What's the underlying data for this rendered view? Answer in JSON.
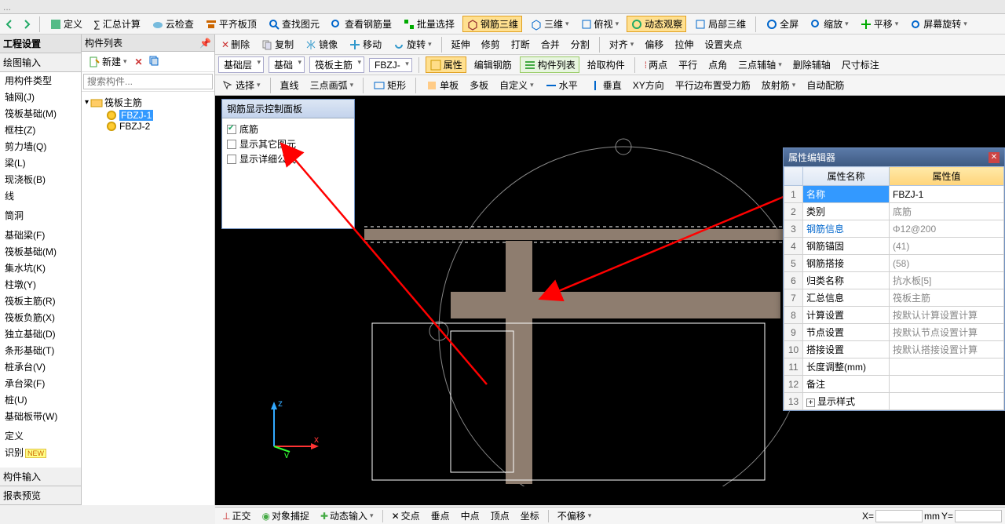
{
  "top_menu_tail": "...",
  "toolbar1": {
    "ding": "定义",
    "summary": "∑ 汇总计算",
    "cloud": "云检查",
    "align_top": "平齐板顶",
    "find_el": "查找图元",
    "find_rebar": "查看钢筋量",
    "batch_sel": "批量选择",
    "rebar_3d": "钢筋三维",
    "sanwei": "三维",
    "fushi": "俯视",
    "dyn_obs": "动态观察",
    "local_3d": "局部三维",
    "full": "全屏",
    "zoom": "缩放",
    "pan": "平移",
    "rot_scr": "屏幕旋转"
  },
  "toolbar2": {
    "del": "删除",
    "copy": "复制",
    "mirror": "镜像",
    "move": "移动",
    "rotate": "旋转",
    "ext": "延伸",
    "trim": "修剪",
    "break": "打断",
    "merge": "合并",
    "split": "分割",
    "align": "对齐",
    "offset": "偏移",
    "stretch": "拉伸",
    "set_pt": "设置夹点"
  },
  "toolbar3": {
    "layer": "基础层",
    "group": "基础",
    "sub": "筏板主筋",
    "code": "FBZJ-",
    "attr": "属性",
    "edit_rb": "编辑钢筋",
    "comp_list": "构件列表",
    "pick": "拾取构件",
    "two_pt": "两点",
    "parallel": "平行",
    "pt_ang": "点角",
    "tri_aux": "三点辅轴",
    "del_aux": "删除辅轴",
    "dim": "尺寸标注"
  },
  "toolbar4": {
    "select": "选择",
    "line": "直线",
    "arc3": "三点画弧",
    "rect": "矩形",
    "single": "单板",
    "multi": "多板",
    "custom": "自定义",
    "horiz": "水平",
    "vert": "垂直",
    "xy": "XY方向",
    "par_side": "平行边布置受力筋",
    "rad": "放射筋",
    "auto": "自动配筋"
  },
  "eng": {
    "title": "工程设置",
    "draw_in": "绘图输入"
  },
  "left_items": [
    "用构件类型",
    "轴网(J)",
    "筏板基础(M)",
    "框柱(Z)",
    "剪力墙(Q)",
    "梁(L)",
    "现浇板(B)",
    "线",
    "",
    "筒洞",
    "",
    "基础梁(F)",
    "筏板基础(M)",
    "集水坑(K)",
    "柱墩(Y)",
    "筏板主筋(R)",
    "筏板负筋(X)",
    "独立基础(D)",
    "条形基础(T)",
    "桩承台(V)",
    "承台梁(F)",
    "桩(U)",
    "基础板带(W)",
    "",
    "定义",
    "识别"
  ],
  "left_new_badge": "NEW",
  "left_footer": [
    "构件输入",
    "报表预览"
  ],
  "tree": {
    "title": "构件列表",
    "new_btn": "新建",
    "search_ph": "搜索构件...",
    "root": "筏板主筋",
    "c1": "FBZJ-1",
    "c2": "FBZJ-2"
  },
  "rebar_panel": {
    "title": "钢筋显示控制面板",
    "opt1": "底筋",
    "opt2": "显示其它图元",
    "opt3": "显示详细公式"
  },
  "status": {
    "ortho": "正交",
    "snap": "对象捕捉",
    "dyn_in": "动态输入",
    "cross": "交点",
    "vert": "垂点",
    "mid": "中点",
    "vertex": "顶点",
    "sit": "坐标",
    "no_off": "不偏移",
    "xl": "X=",
    "mm": "mm",
    "yl": "Y="
  },
  "prop": {
    "title": "属性编辑器",
    "h_name": "属性名称",
    "h_val": "属性值",
    "rows": [
      {
        "n": "1",
        "k": "名称",
        "v": "FBZJ-1",
        "sel": true
      },
      {
        "n": "2",
        "k": "类别",
        "v": "底筋"
      },
      {
        "n": "3",
        "k": "钢筋信息",
        "v": "Φ12@200",
        "blue": true
      },
      {
        "n": "4",
        "k": "钢筋锚固",
        "v": "(41)"
      },
      {
        "n": "5",
        "k": "钢筋搭接",
        "v": "(58)"
      },
      {
        "n": "6",
        "k": "归类名称",
        "v": "抗水板[5]"
      },
      {
        "n": "7",
        "k": "汇总信息",
        "v": "筏板主筋"
      },
      {
        "n": "8",
        "k": "计算设置",
        "v": "按默认计算设置计算"
      },
      {
        "n": "9",
        "k": "节点设置",
        "v": "按默认节点设置计算"
      },
      {
        "n": "10",
        "k": "搭接设置",
        "v": "按默认搭接设置计算"
      },
      {
        "n": "11",
        "k": "长度调整(mm)",
        "v": ""
      },
      {
        "n": "12",
        "k": "备注",
        "v": ""
      },
      {
        "n": "13",
        "k": "显示样式",
        "v": "",
        "exp": true
      }
    ]
  }
}
